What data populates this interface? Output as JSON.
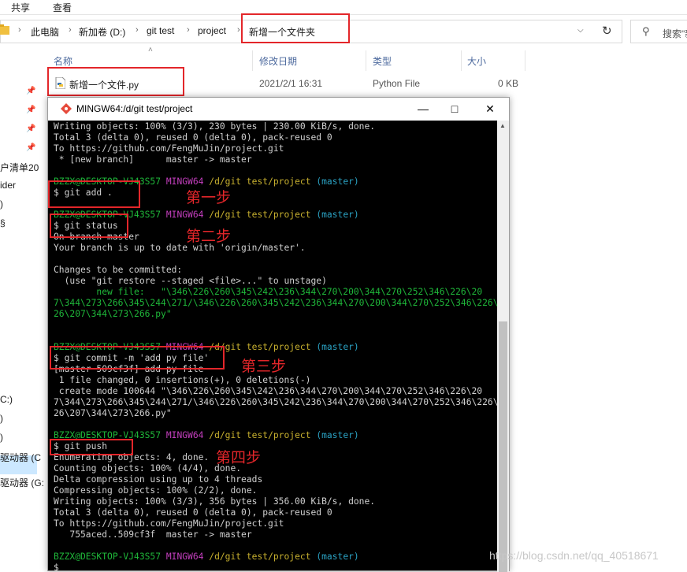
{
  "ribbon": {
    "share": "共享",
    "view": "查看"
  },
  "address": {
    "segments": [
      "此电脑",
      "新加卷 (D:)",
      "git test",
      "project",
      "新增一个文件夹"
    ],
    "search_placeholder": "搜索\"新"
  },
  "columns": {
    "name": "名称",
    "modified": "修改日期",
    "type": "类型",
    "size": "大小"
  },
  "file": {
    "name": "新增一个文件.py",
    "modified": "2021/2/1 16:31",
    "type": "Python File",
    "size": "0 KB"
  },
  "nav": {
    "items": [
      "户清单20",
      "ider",
      ")",
      "§",
      "C:)",
      ")",
      ")",
      "驱动器 (C",
      "驱动器 (G:"
    ]
  },
  "terminal": {
    "title": "MINGW64:/d/git test/project",
    "prompt": {
      "user": "BZZX@DESKTOP-VJ43S57",
      "env": "MINGW64",
      "path": "/d/git test/project",
      "branch": "(master)"
    },
    "lines": {
      "l1": "Writing objects: 100% (3/3), 230 bytes | 230.00 KiB/s, done.",
      "l2": "Total 3 (delta 0), reused 0 (delta 0), pack-reused 0",
      "l3": "To https://github.com/FengMuJin/project.git",
      "l4": " * [new branch]      master -> master",
      "cmd1": "$ git add .",
      "cmd2": "$ git status",
      "s1": "On branch master",
      "s2": "Your branch is up to date with 'origin/master'.",
      "s3": "Changes to be committed:",
      "s4": "  (use \"git restore --staged <file>...\" to unstage)",
      "s5a": "        ",
      "s5b": "new file:   \"\\346\\226\\260\\345\\242\\236\\344\\270\\200\\344\\270\\252\\346\\226\\20",
      "s6": "7\\344\\273\\266\\345\\244\\271/\\346\\226\\260\\345\\242\\236\\344\\270\\200\\344\\270\\252\\346\\226\\2",
      "s7": "26\\207\\344\\273\\266.py\"",
      "cmd3": "$ git commit -m 'add py file'",
      "c1": "[master 509cf3f] add py file",
      "c2": " 1 file changed, 0 insertions(+), 0 deletions(-)",
      "c3": " create mode 100644 \"\\346\\226\\260\\345\\242\\236\\344\\270\\200\\344\\270\\252\\346\\226\\20",
      "c4": "7\\344\\273\\266\\345\\244\\271/\\346\\226\\260\\345\\242\\236\\344\\270\\200\\344\\270\\252\\346\\226\\2",
      "c5": "26\\207\\344\\273\\266.py\"",
      "cmd4": "$ git push",
      "p1": "Enumerating objects: 4, done.",
      "p2": "Counting objects: 100% (4/4), done.",
      "p3": "Delta compression using up to 4 threads",
      "p4": "Compressing objects: 100% (2/2), done.",
      "p5": "Writing objects: 100% (3/3), 356 bytes | 356.00 KiB/s, done.",
      "p6": "Total 3 (delta 0), reused 0 (delta 0), pack-reused 0",
      "p7": "To https://github.com/FengMuJin/project.git",
      "p8": "   755aced..509cf3f  master -> master",
      "last": "$"
    }
  },
  "steps": {
    "s1": "第一步",
    "s2": "第二步",
    "s3": "第三步",
    "s4": "第四步"
  },
  "watermark": "https://blog.csdn.net/qq_40518671",
  "colors": {
    "highlight": "#e3262a",
    "prompt_green": "#1fb83a",
    "prompt_magenta": "#c53fbf",
    "path_yellow": "#c8b12f",
    "branch_cyan": "#2ba3c4"
  },
  "icons": [
    "folder-icon",
    "chevron-right-icon",
    "chevron-down-icon",
    "refresh-icon",
    "search-icon",
    "python-file-icon",
    "pin-icon",
    "git-bash-icon",
    "minimize-icon",
    "maximize-icon",
    "close-icon"
  ]
}
